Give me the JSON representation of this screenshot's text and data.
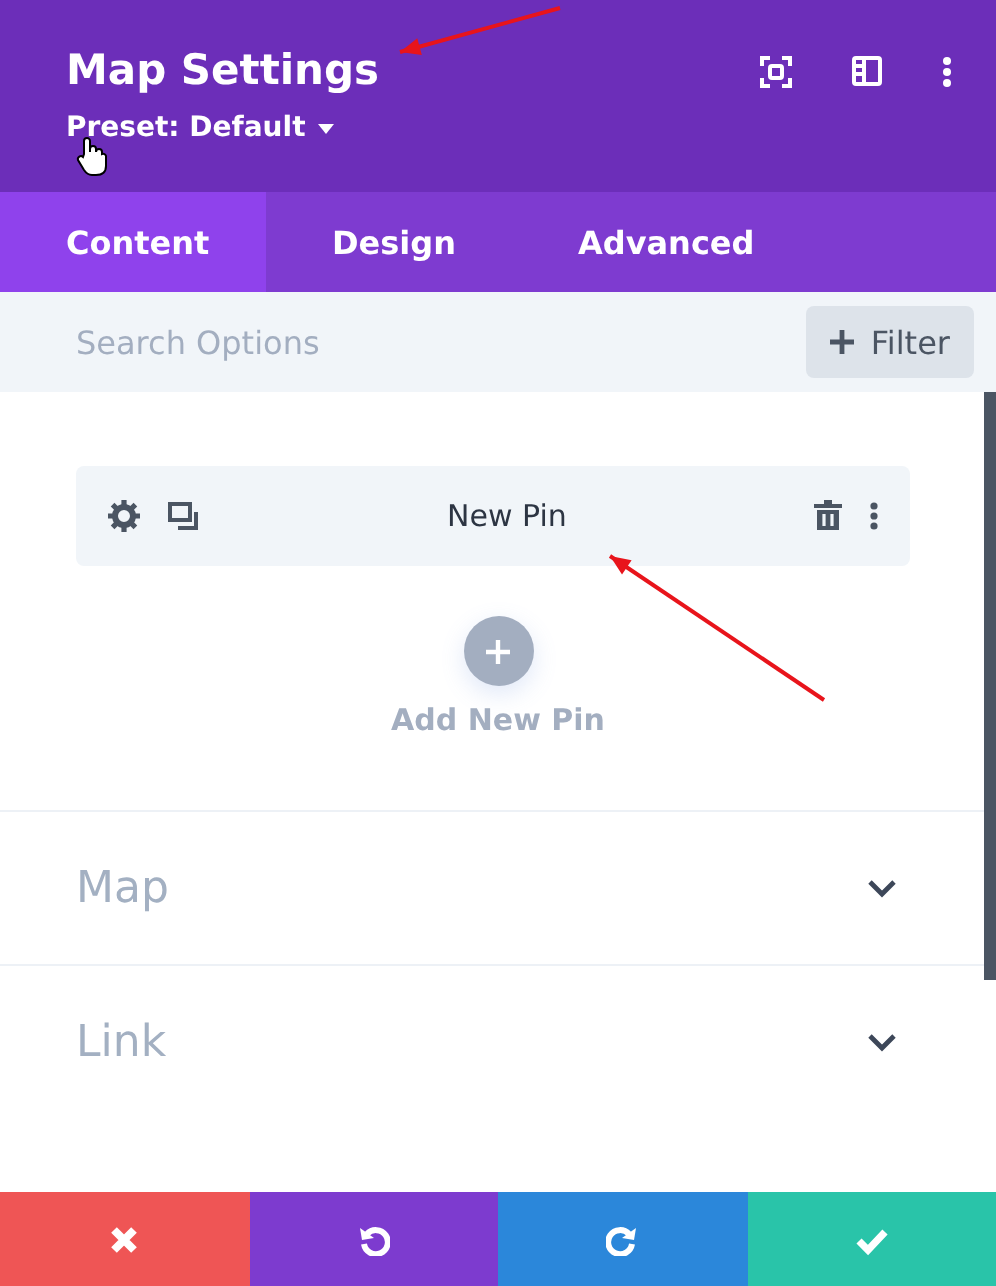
{
  "header": {
    "title": "Map Settings",
    "preset": "Preset: Default"
  },
  "tabs": [
    {
      "label": "Content",
      "selected": true
    },
    {
      "label": "Design",
      "selected": false
    },
    {
      "label": "Advanced",
      "selected": false
    }
  ],
  "search": {
    "placeholder": "Search Options",
    "filter_label": "Filter"
  },
  "pins": [
    {
      "label": "New Pin"
    }
  ],
  "add_pin": {
    "label": "Add New Pin"
  },
  "sections": [
    {
      "title": "Map",
      "expanded": false
    },
    {
      "title": "Link",
      "expanded": false
    }
  ],
  "footer_buttons": [
    {
      "kind": "cancel"
    },
    {
      "kind": "undo"
    },
    {
      "kind": "redo"
    },
    {
      "kind": "save"
    }
  ],
  "annotations": [
    {
      "kind": "arrow"
    },
    {
      "kind": "arrow"
    }
  ]
}
